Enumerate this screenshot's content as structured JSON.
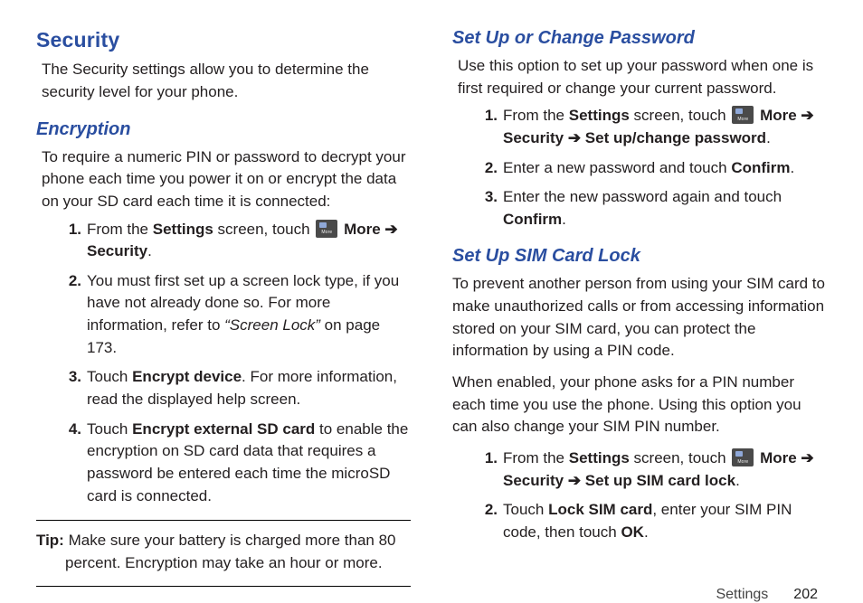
{
  "left": {
    "security_title": "Security",
    "security_intro": "The Security settings allow you to determine the security level for your phone.",
    "encryption_title": "Encryption",
    "encryption_intro": "To require a numeric PIN or password to decrypt your phone each time you power it on or encrypt the data on your SD card each time it is connected:",
    "steps": {
      "n1": "1.",
      "s1_a": "From the ",
      "s1_b": "Settings",
      "s1_c": " screen, touch ",
      "s1_more": "More",
      "s1_arrow": " ➔ ",
      "s1_d": "Security",
      "s1_e": ".",
      "n2": "2.",
      "s2_a": "You must first set up a screen lock type, if you have not already done so. For more information, refer to ",
      "s2_b": "“Screen Lock”",
      "s2_c": "  on page 173.",
      "n3": "3.",
      "s3_a": "Touch ",
      "s3_b": "Encrypt device",
      "s3_c": ". For more information, read the displayed help screen.",
      "n4": "4.",
      "s4_a": "Touch ",
      "s4_b": "Encrypt external SD card",
      "s4_c": " to enable the encryption on SD card data that requires a password be entered each time the microSD card is connected."
    },
    "tip_label": "Tip: ",
    "tip_text": "Make sure your battery is charged more than 80 percent. Encryption may take an hour or more."
  },
  "right": {
    "pwd_title": "Set Up or Change Password",
    "pwd_intro": "Use this option to set up your password when one is first required or change your current password.",
    "pwd_steps": {
      "n1": "1.",
      "p1_a": "From the ",
      "p1_b": "Settings",
      "p1_c": " screen, touch ",
      "p1_more": "More",
      "p1_arrow1": " ➔ ",
      "p1_d": "Security",
      "p1_arrow2": " ➔ ",
      "p1_e": "Set up/change password",
      "p1_f": ".",
      "n2": "2.",
      "p2_a": "Enter a new password and touch ",
      "p2_b": "Confirm",
      "p2_c": ".",
      "n3": "3.",
      "p3_a": "Enter the new password again and touch ",
      "p3_b": "Confirm",
      "p3_c": "."
    },
    "sim_title": "Set Up SIM Card Lock",
    "sim_intro1": "To prevent another person from using your SIM card to make unauthorized calls or from accessing information stored on your SIM card, you can protect the information by using a PIN code.",
    "sim_intro2": "When enabled, your phone asks for a PIN number each time you use the phone. Using this option you can also change your SIM PIN number.",
    "sim_steps": {
      "n1": "1.",
      "s1_a": "From the ",
      "s1_b": "Settings",
      "s1_c": " screen, touch ",
      "s1_more": "More",
      "s1_arrow1": " ➔ ",
      "s1_d": "Security",
      "s1_arrow2": " ➔ ",
      "s1_e": "Set up SIM card lock",
      "s1_f": ".",
      "n2": "2.",
      "s2_a": "Touch ",
      "s2_b": "Lock SIM card",
      "s2_c": ", enter your SIM PIN code, then touch ",
      "s2_d": "OK",
      "s2_e": "."
    }
  },
  "footer": {
    "section": "Settings",
    "page": "202"
  }
}
